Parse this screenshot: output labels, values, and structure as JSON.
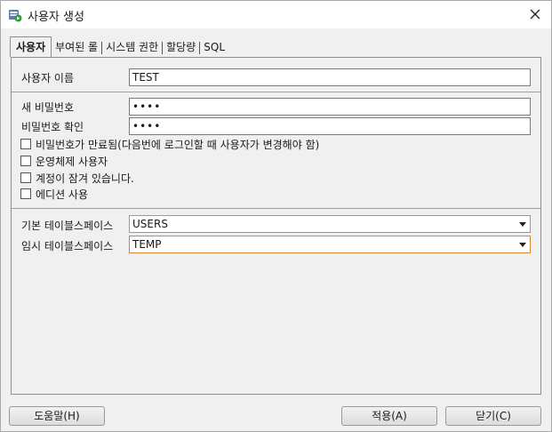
{
  "window": {
    "title": "사용자 생성",
    "icon": "create-user-icon",
    "close_icon": "close-icon"
  },
  "tabs": [
    {
      "label": "사용자",
      "active": true
    },
    {
      "label": "부여된 롤",
      "active": false
    },
    {
      "label": "시스템 권한",
      "active": false
    },
    {
      "label": "할당량",
      "active": false
    },
    {
      "label": "SQL",
      "active": false
    }
  ],
  "user": {
    "name_label": "사용자 이름",
    "name_value": "TEST",
    "new_password_label": "새 비밀번호",
    "new_password_value": "••••",
    "confirm_password_label": "비밀번호 확인",
    "confirm_password_value": "••••"
  },
  "options": [
    {
      "label": "비밀번호가 만료됨(다음번에 로그인할 때 사용자가 변경해야 함)",
      "checked": false
    },
    {
      "label": "운영체제 사용자",
      "checked": false
    },
    {
      "label": "계정이 잠겨 있습니다.",
      "checked": false
    },
    {
      "label": "에디션 사용",
      "checked": false
    }
  ],
  "tablespaces": {
    "default_label": "기본 테이블스페이스",
    "default_value": "USERS",
    "temp_label": "임시 테이블스페이스",
    "temp_value": "TEMP"
  },
  "footer": {
    "help_label": "도움말(H)",
    "apply_label": "적용(A)",
    "close_label": "닫기(C)"
  },
  "colors": {
    "focus_border": "#d6862e",
    "dialog_bg": "#f0f0f0"
  }
}
